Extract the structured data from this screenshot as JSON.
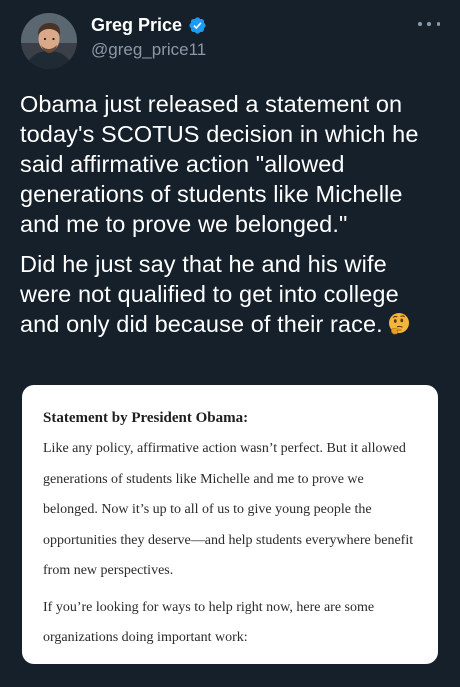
{
  "author": {
    "display_name": "Greg Price",
    "handle": "@greg_price11",
    "verified": true,
    "avatar_icon": "profile-photo",
    "verified_color": "#1d9bf0"
  },
  "menu": {
    "icon": "more-dots-icon"
  },
  "tweet": {
    "paragraph_1": "Obama just released a statement on today's SCOTUS decision in which he said affirmative action \"allowed generations of students like Michelle and me to prove we belonged.\"",
    "paragraph_2": "Did he just say that he and his wife were not qualified to get into college and only did because of their race.",
    "emoji": "thinking-face"
  },
  "statement_card": {
    "heading": "Statement by President Obama:",
    "paragraph_1": "Like any policy, affirmative action wasn’t perfect. But it allowed generations of students like Michelle and me to prove we belonged. Now it’s up to all of us to give young people the opportunities they deserve—and help students everywhere benefit from new perspectives.",
    "paragraph_2": "If you’re looking for ways to help right now, here are some organizations doing important work:"
  },
  "colors": {
    "background": "#15202b",
    "text": "#ffffff",
    "secondary_text": "#8b98a5",
    "card_background": "#ffffff"
  }
}
